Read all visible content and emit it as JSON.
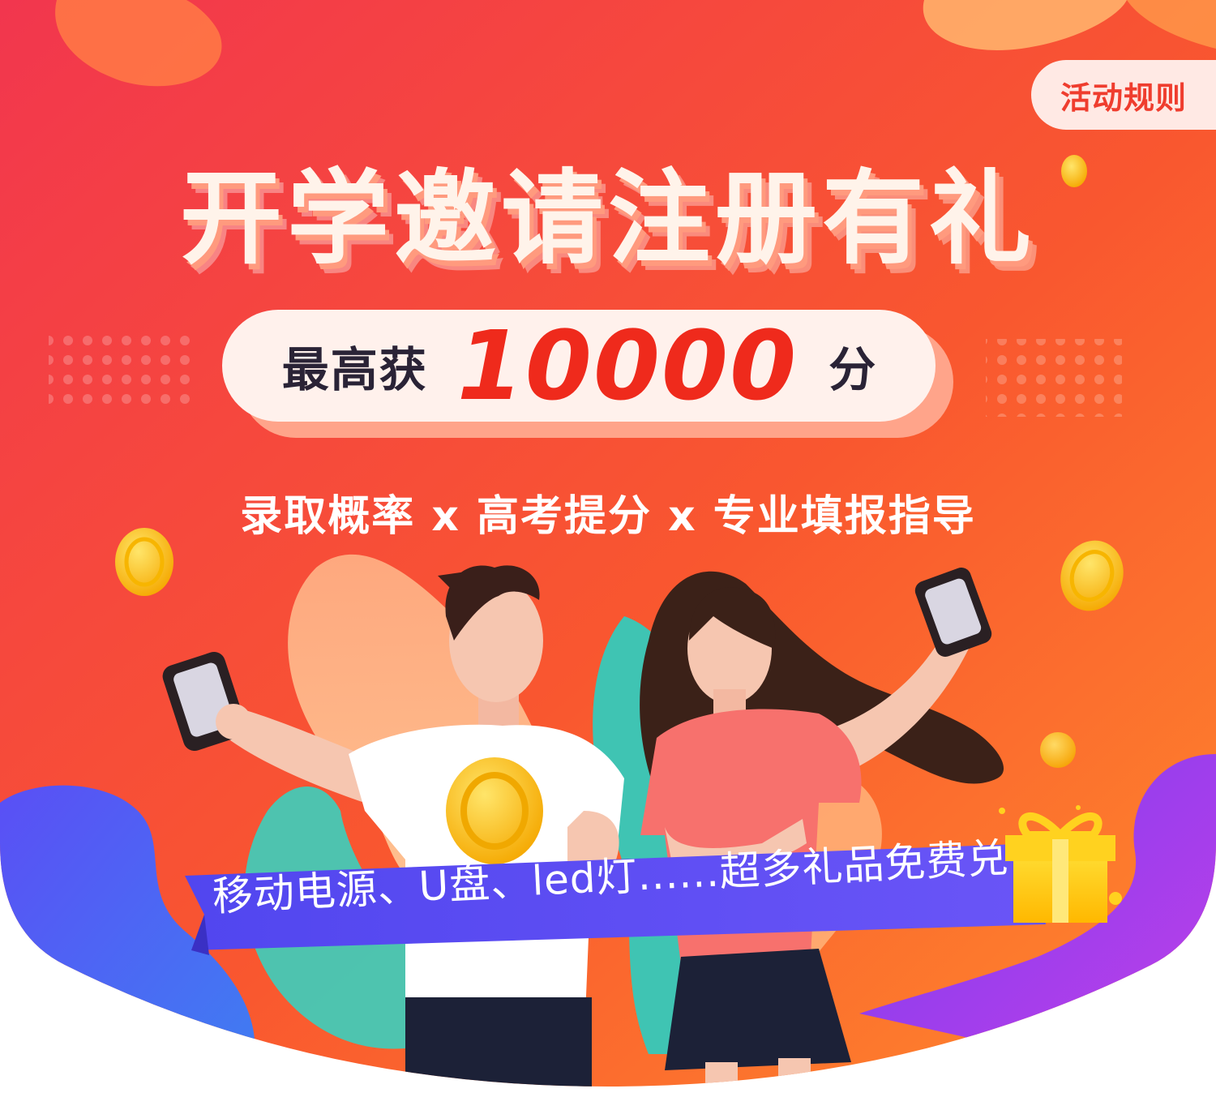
{
  "header": {
    "rules_button": "活动规则",
    "title": "开学邀请注册有礼"
  },
  "reward": {
    "prefix": "最高获",
    "amount": "10000",
    "unit": "分"
  },
  "subtitle": "录取概率 x 高考提分 x 专业填报指导",
  "ribbon": {
    "text": "移动电源、U盘、led灯......超多礼品免费兑"
  },
  "colors": {
    "bg_top": "#f03a4b",
    "bg_bottom": "#ff7a2c",
    "accent_red": "#ef2a1c",
    "ribbon": "#5b4bf2",
    "gold": "#ffc21a"
  },
  "icons": [
    "coin-icon",
    "gift-box-icon",
    "phone-icon"
  ]
}
